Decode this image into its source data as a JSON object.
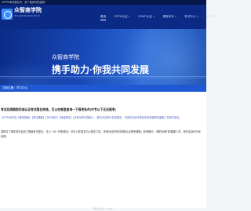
{
  "topbar": {
    "text": "CIPPM考试报名中，多个培训可供选择！"
  },
  "header": {
    "brand": "众智商学院",
    "tagline": "Zhongzhi Business School",
    "nav": [
      {
        "label": "首页",
        "active": true
      },
      {
        "label": "CPPM认证",
        "active": false,
        "dropdown": true
      },
      {
        "label": "SCMP认证",
        "active": false,
        "dropdown": true
      },
      {
        "label": "课程体系",
        "active": false,
        "dropdown": true
      },
      {
        "label": "考试中心",
        "active": false,
        "dropdown": true
      },
      {
        "label": "学习中",
        "active": false
      }
    ]
  },
  "banner": {
    "small": "众智商学院",
    "big": "携手助力·你我共同发展"
  },
  "strip": {
    "label": "当前位置：学习中心"
  },
  "article": {
    "title": "考试后续跟踪问询认证考试报名资格，可以在哪里查询一下报考条件(中专以下无法报考)",
    "links": "【CPPM考试】【报考指南】【考试通知】【关于我们】【快速报名】【手机号考试报名】，若仍无法进行在线报名，可查看当地代表处查询或者联系客服人员进行报名。",
    "para": "若报名了现在的社会劳工等级考试报名，可以一对一协助报名；也可以在报名中心报名之前，查看对应的考试资格认证报考课程；若有疑问，请联系我们的客服人员，我们会及时为你处理。"
  },
  "footer": {
    "text": "联系方式：contact"
  }
}
